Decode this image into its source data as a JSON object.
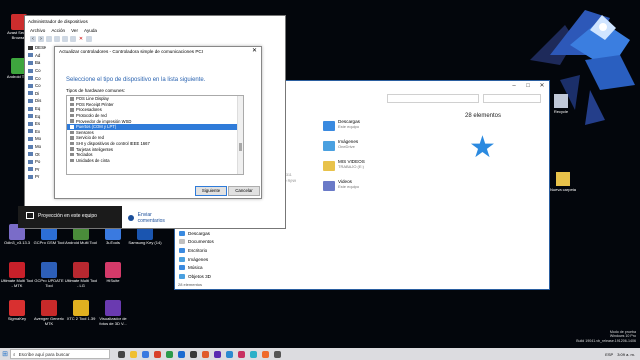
{
  "desktop": {
    "left_icons": [
      {
        "label": "Avast Secure Browser",
        "color": "#cc2d2d"
      },
      {
        "label": "Android Tools",
        "color": "#3ea63e"
      },
      {
        "label": "Odin3_v3.13.3",
        "color": "#7a6cc8"
      },
      {
        "label": "GCPro GSM Tool",
        "color": "#2c6fd6"
      },
      {
        "label": "Android Multi Tool",
        "color": "#4a8c3a"
      },
      {
        "label": "3uTools",
        "color": "#3a7ae0"
      },
      {
        "label": "Samsung Key (14)",
        "color": "#1a55b0"
      },
      {
        "label": "Ultimate Multi Tool - MTK",
        "color": "#c8202a"
      },
      {
        "label": "GCPro UPDATE Tool",
        "color": "#2d5fb8"
      },
      {
        "label": "Ultimate Multi Tool - LG",
        "color": "#b82830"
      },
      {
        "label": "HiSuite",
        "color": "#d43a6a"
      },
      {
        "label": "SigmaKey",
        "color": "#d83030"
      },
      {
        "label": "Avenger Generic MTK",
        "color": "#c82a2a"
      },
      {
        "label": "XTC 2 Tool 1.39",
        "color": "#e0b020"
      },
      {
        "label": "Visualizador de fotos de 3D V...",
        "color": "#6a3ab0"
      }
    ],
    "right_icons": [
      {
        "label": "Recycle",
        "color": "#c0c8d8"
      },
      {
        "label": "Nueva carpeta",
        "color": "#e8c24a"
      }
    ],
    "watermark": [
      "Modo de prueba",
      "Windows 10 Pro",
      "Build 19041.vb_release.191206-1406",
      "3:09 a. m."
    ]
  },
  "device_manager": {
    "title": "Administrador de dispositivos",
    "menus": [
      "Archivo",
      "Acción",
      "Ver",
      "Ayuda"
    ],
    "tree": [
      "DESKTOP",
      "Ad",
      "Ba",
      "Co",
      "Co",
      "Co",
      "Di",
      "Dis",
      "Eq",
      "Eq",
      "Es",
      "Ex",
      "Mo",
      "Mo",
      "Ot",
      "Po",
      "Pr",
      "Pr"
    ]
  },
  "wizard": {
    "title": "Actualizar controladores - Controladora simple de comunicaciones PCI",
    "heading": "Seleccione el tipo de dispositivo en la lista siguiente.",
    "list_label": "Tipos de hardware comunes:",
    "items": [
      "POS Line Display",
      "POS Receipt Printer",
      "Procesadores",
      "Protocolo de red",
      "Proveedor de impresión WSD",
      "Puertos (COM y LPT)",
      "Sensores",
      "Servicio de red",
      "SHI y dispositivos de control IEEE 1667",
      "Tarjetas inteligentes",
      "Teclados",
      "Unidades de cinta"
    ],
    "selected_index": 5,
    "next_label": "Siguiente",
    "cancel_label": "Cancelar"
  },
  "settings": {
    "projection_label": "Proyección en este equipo",
    "link_label": "Enviar comentarios"
  },
  "explorer": {
    "recent_title": "28 elementos",
    "files": [
      {
        "name": "Descargas",
        "sub": "Este equipo",
        "color": "#3a8ae0"
      },
      {
        "name": "Imágenes",
        "sub": "OneDrive",
        "color": "#4aa0e0"
      },
      {
        "name": "MIS VIDEOS",
        "sub": "TRABAJO (E:)",
        "color": "#e8c24a"
      },
      {
        "name": "Videos",
        "sub": "Este equipo",
        "color": "#6a7ac8"
      }
    ],
    "side_labels": [
      "H5 TIRE",
      "O-(N900) 311",
      "TRABAJO R(N9"
    ],
    "nav": [
      {
        "name": "Descargas",
        "color": "#3a8ae0"
      },
      {
        "name": "Documentos",
        "color": "#c0c0c0"
      },
      {
        "name": "Escritorio",
        "color": "#3a8ae0"
      },
      {
        "name": "Imágenes",
        "color": "#4aa0e0"
      },
      {
        "name": "Música",
        "color": "#3a8ae0"
      },
      {
        "name": "Objetos 3D",
        "color": "#4aa0e0"
      }
    ],
    "status": "28 elementos"
  },
  "taskbar": {
    "search_placeholder": "Escribe aquí para buscar",
    "app_colors": [
      "#444",
      "#f0c030",
      "#3a7ae0",
      "#d8402a",
      "#2a9a4a",
      "#1a6ad0",
      "#3a3a3a",
      "#e05a2a",
      "#5a2ab0",
      "#2a8ad0",
      "#c83060",
      "#2ab0c8",
      "#f06a2a",
      "#555"
    ],
    "tray": [
      "ESP",
      "3:09 a. m."
    ]
  }
}
